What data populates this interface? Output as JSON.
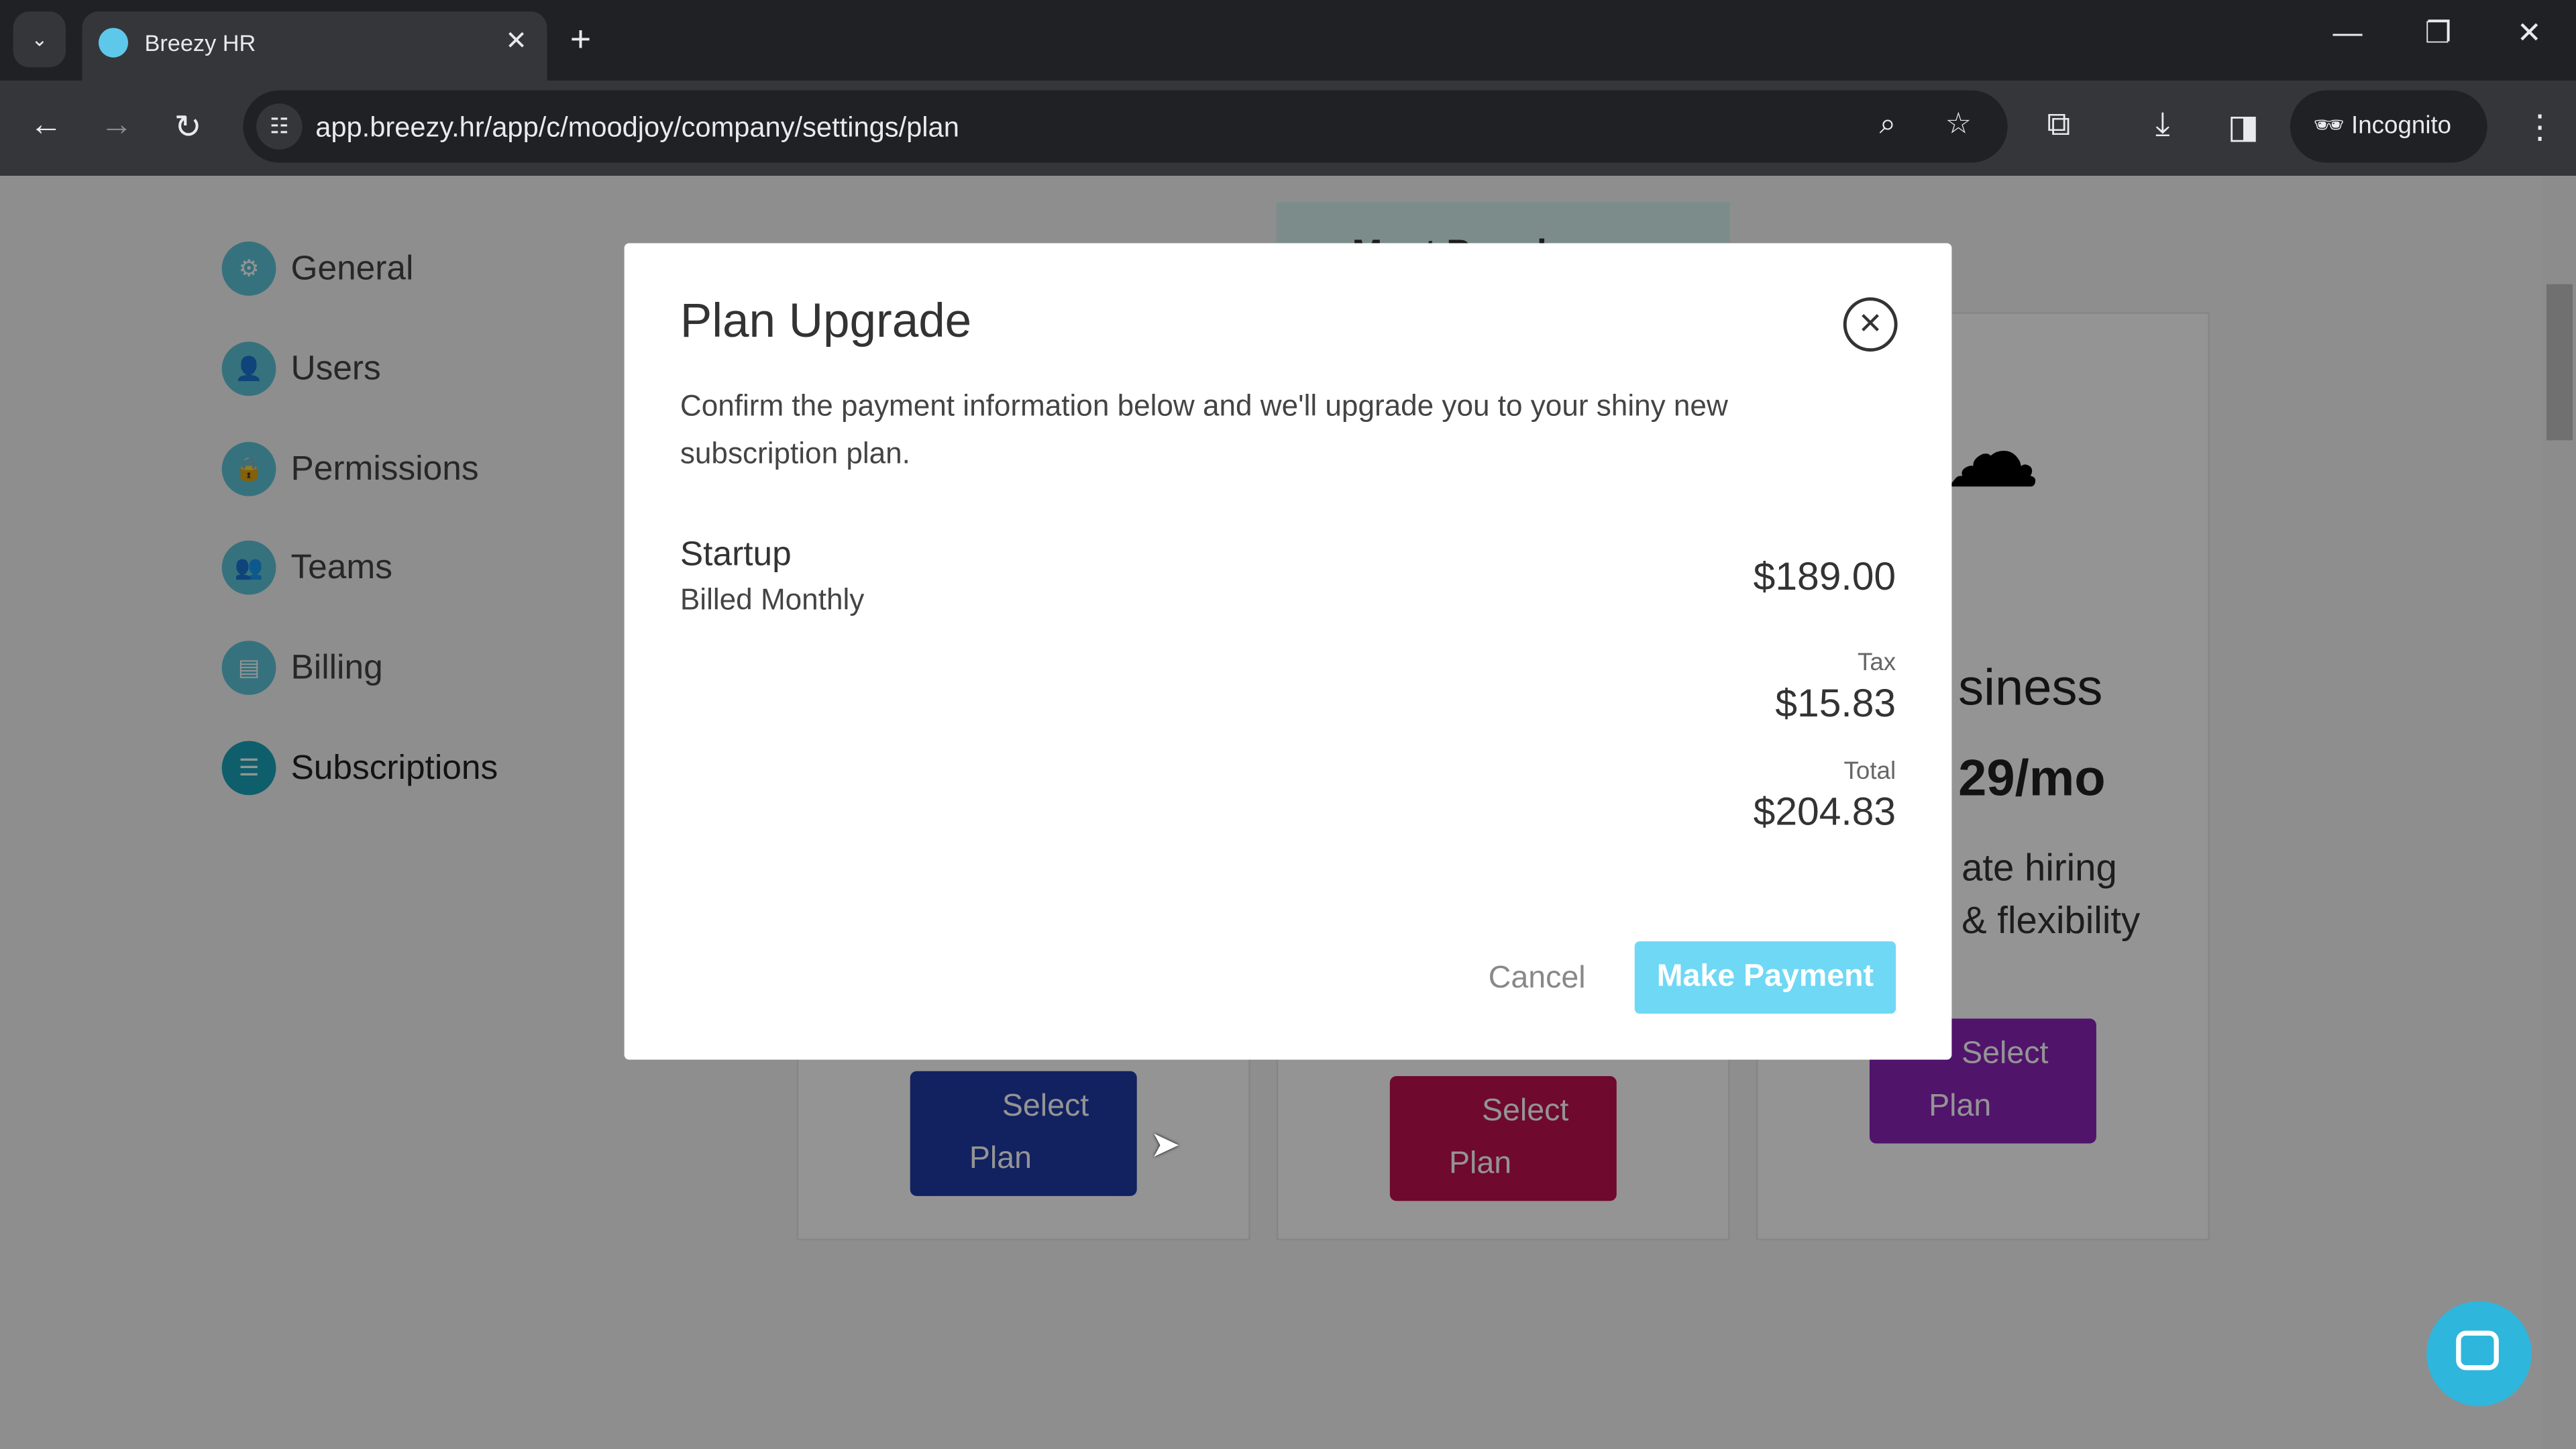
{
  "browser": {
    "tab_title": "Breezy HR",
    "url": "app.breezy.hr/app/c/moodjoy/company/settings/plan",
    "incognito_label": "Incognito"
  },
  "sidebar": {
    "items": [
      {
        "label": "General",
        "icon": "gear-icon"
      },
      {
        "label": "Users",
        "icon": "user-icon"
      },
      {
        "label": "Permissions",
        "icon": "lock-icon"
      },
      {
        "label": "Teams",
        "icon": "team-icon"
      },
      {
        "label": "Billing",
        "icon": "card-icon"
      },
      {
        "label": "Subscriptions",
        "icon": "list-icon"
      }
    ]
  },
  "plans": {
    "badge": "Most Popular",
    "business_name": "siness",
    "business_price": "29/mo",
    "business_desc1": "ate hiring",
    "business_desc2": "& flexibility",
    "select_line1": "Select",
    "select_line2": "Plan",
    "colors": {
      "startup": "#1f3aa6",
      "growth": "#c0114f",
      "business": "#8a23b8"
    }
  },
  "modal": {
    "title": "Plan Upgrade",
    "description": "Confirm the payment information below and we'll upgrade you to your shiny new subscription plan.",
    "plan_name": "Startup",
    "billing": "Billed Monthly",
    "price": "$189.00",
    "tax_label": "Tax",
    "tax": "$15.83",
    "total_label": "Total",
    "total": "$204.83",
    "cancel_label": "Cancel",
    "pay_label": "Make Payment",
    "accent": "#6fd8f4"
  }
}
